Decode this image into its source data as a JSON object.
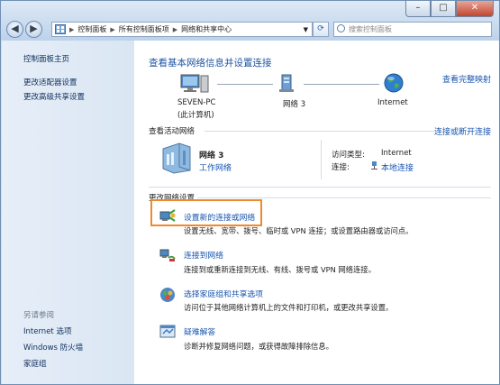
{
  "window": {
    "address": [
      "控制面板",
      "所有控制面板项",
      "网络和共享中心"
    ],
    "search_placeholder": "搜索控制面板",
    "min": "–",
    "max": "□",
    "close": "✕"
  },
  "sidebar": {
    "home": "控制面板主页",
    "items": [
      "更改适配器设置",
      "更改高级共享设置"
    ],
    "see_also_title": "另请参阅",
    "see_also": [
      "Internet 选项",
      "Windows 防火墙",
      "家庭组"
    ]
  },
  "main": {
    "title": "查看基本网络信息并设置连接",
    "full_map": "查看完整映射",
    "nodes": {
      "pc_name": "SEVEN-PC",
      "pc_sub": "(此计算机)",
      "network": "网络  3",
      "internet": "Internet"
    },
    "active_title": "查看活动网络",
    "connect_disconnect": "连接或断开连接",
    "active": {
      "name": "网络  3",
      "type_link": "工作网络",
      "access_label": "访问类型:",
      "access_value": "Internet",
      "conn_label": "连接:",
      "conn_value": "本地连接"
    },
    "change_title": "更改网络设置",
    "tasks": [
      {
        "title": "设置新的连接或网络",
        "desc": "设置无线、宽带、拨号、临时或 VPN 连接；或设置路由器或访问点。"
      },
      {
        "title": "连接到网络",
        "desc": "连接到或重新连接到无线、有线、拨号或 VPN 网络连接。"
      },
      {
        "title": "选择家庭组和共享选项",
        "desc": "访问位于其他网络计算机上的文件和打印机，或更改共享设置。"
      },
      {
        "title": "疑难解答",
        "desc": "诊断并修复网络问题，或获得故障排除信息。"
      }
    ]
  }
}
